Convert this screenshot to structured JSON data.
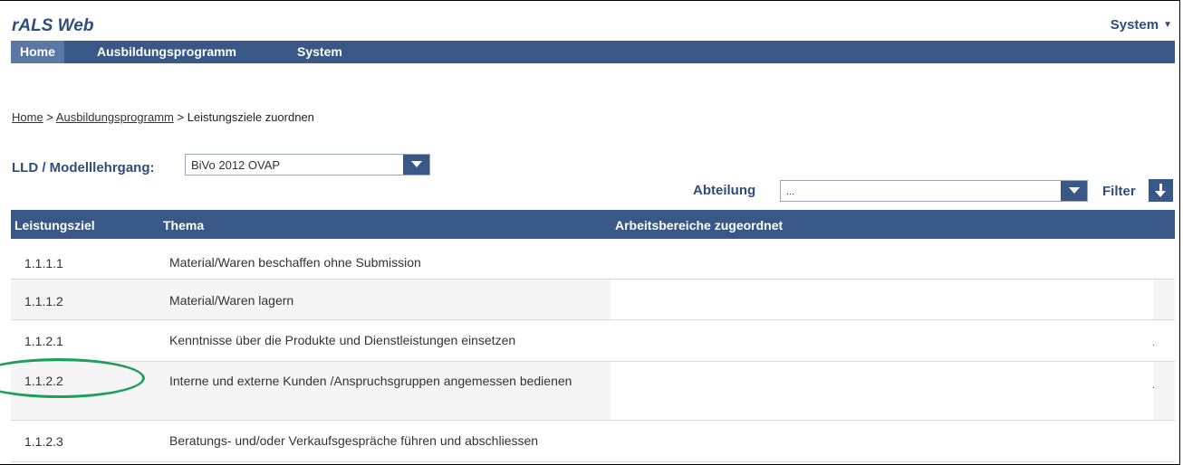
{
  "app": {
    "title": "rALS Web",
    "system_menu": "System"
  },
  "nav": [
    {
      "label": "Home",
      "active": true
    },
    {
      "label": "Ausbildungsprogramm"
    },
    {
      "label": "System"
    }
  ],
  "breadcrumb": {
    "home": "Home",
    "sep1": " > ",
    "ausb": "Ausbildungsprogramm",
    "sep2": " > ",
    "current": "Leistungsziele zuordnen"
  },
  "filters": {
    "lld_label": "LLD / Modelllehrgang:",
    "lld_value": "BiVo 2012 OVAP",
    "abteilung_label": "Abteilung",
    "abteilung_value": "...",
    "filter_label": "Filter"
  },
  "table": {
    "headers": [
      "Leistungsziel",
      "Thema",
      "Arbeitsbereiche zugeordnet"
    ],
    "rows": [
      {
        "id": "1.1.1.1",
        "thema": "Material/Waren beschaffen ohne Submission",
        "marker": ""
      },
      {
        "id": "1.1.1.2",
        "thema": "Material/Waren lagern",
        "marker": ""
      },
      {
        "id": "1.1.2.1",
        "thema": "Kenntnisse über die Produkte und Dienstleistungen einsetzen",
        "marker": "."
      },
      {
        "id": "1.1.2.2",
        "thema": "Interne und externe Kunden /Anspruchsgruppen angemessen bedienen",
        "marker": "."
      },
      {
        "id": "1.1.2.3",
        "thema": "Beratungs- und/oder Verkaufsgespräche führen und abschliessen",
        "marker": ""
      }
    ]
  },
  "colors": {
    "nav_bg": "#3a5887",
    "nav_active": "#5b77a4",
    "label_blue": "#2e4d7b",
    "annotation": "#1ea05a"
  }
}
